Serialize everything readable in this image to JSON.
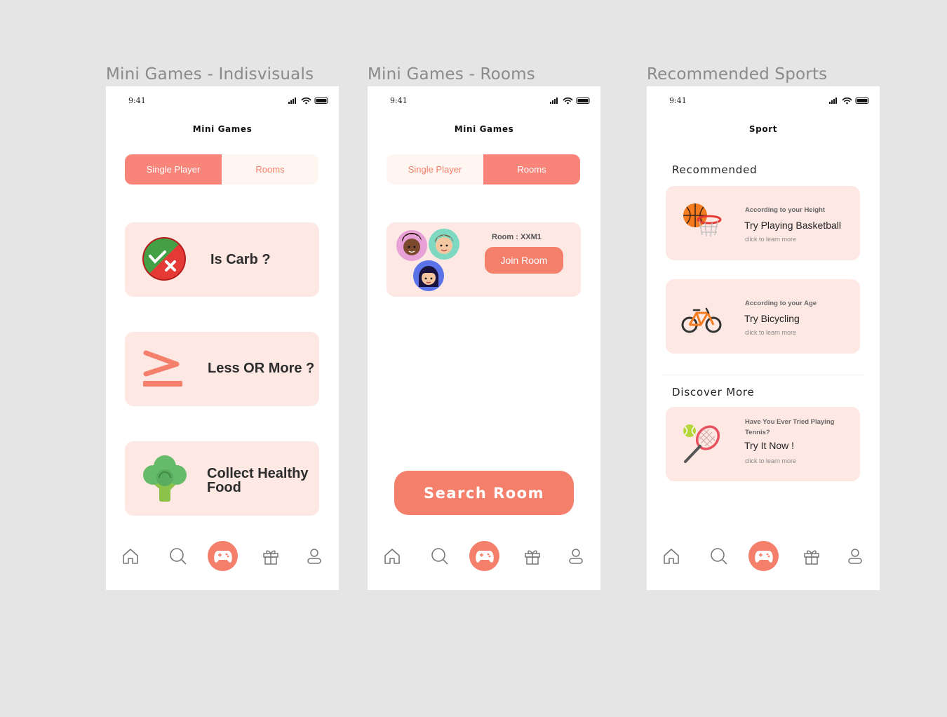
{
  "frames": [
    {
      "frame_title": "Mini Games - Indisvisuals",
      "status_time": "9:41",
      "screen_title": "Mini Games",
      "tabs": [
        {
          "label": "Single Player",
          "active": true
        },
        {
          "label": "Rooms",
          "active": false
        }
      ],
      "games": [
        {
          "label": "Is Carb ?",
          "icon": "check-cross-icon"
        },
        {
          "label": "Less OR More ?",
          "icon": "greater-equal-icon"
        },
        {
          "label": "Collect Healthy Food",
          "icon": "broccoli-icon"
        }
      ]
    },
    {
      "frame_title": "Mini Games - Rooms",
      "status_time": "9:41",
      "screen_title": "Mini Games",
      "tabs": [
        {
          "label": "Single Player",
          "active": false
        },
        {
          "label": "Rooms",
          "active": true
        }
      ],
      "room": {
        "label": "Room : XXM1",
        "join_label": "Join Room"
      },
      "search_label": "Search Room"
    },
    {
      "frame_title": "Recommended Sports",
      "status_time": "9:41",
      "screen_title": "Sport",
      "recommended_heading": "Recommended",
      "discover_heading": "Discover More",
      "recommendations": [
        {
          "subtitle": "According to your Height",
          "title": "Try Playing Basketball",
          "more": "click to learn more",
          "icon": "basketball-icon"
        },
        {
          "subtitle": "According to your Age",
          "title": "Try Bicycling",
          "more": "click to learn more",
          "icon": "bicycle-icon"
        }
      ],
      "discover": {
        "subtitle_line1": "Have You Ever Tried Playing",
        "subtitle_line2": "Tennis?",
        "title": "Try It Now !",
        "more": "click to learn more",
        "icon": "tennis-icon"
      }
    }
  ],
  "nav_items": [
    "home-icon",
    "search-icon",
    "gamepad-icon",
    "gift-icon",
    "profile-icon"
  ],
  "colors": {
    "accent": "#f47f6b",
    "card": "#fde8e4",
    "tab_bg": "#fff6f2",
    "background": "#e5e5e5"
  }
}
